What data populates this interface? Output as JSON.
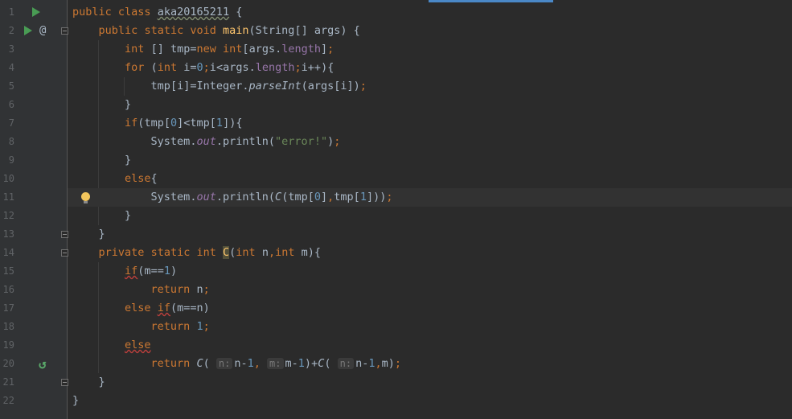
{
  "editor": {
    "lines": [
      {
        "n": "1"
      },
      {
        "n": "2"
      },
      {
        "n": "3"
      },
      {
        "n": "4"
      },
      {
        "n": "5"
      },
      {
        "n": "6"
      },
      {
        "n": "7"
      },
      {
        "n": "8"
      },
      {
        "n": "9"
      },
      {
        "n": "10"
      },
      {
        "n": "11"
      },
      {
        "n": "12"
      },
      {
        "n": "13"
      },
      {
        "n": "14"
      },
      {
        "n": "15"
      },
      {
        "n": "16"
      },
      {
        "n": "17"
      },
      {
        "n": "18"
      },
      {
        "n": "19"
      },
      {
        "n": "20"
      },
      {
        "n": "21"
      },
      {
        "n": "22"
      }
    ],
    "tok": {
      "public": "public",
      "class": "class",
      "classname": "aka20165211",
      "lbrace": "{",
      "rbrace": "}",
      "static": "static",
      "void": "void",
      "main": "main",
      "string": "String",
      "arr": "[]",
      "args": "args",
      "lparen": "(",
      "rparen": ")",
      "int": "int",
      "tmp": "tmp",
      "eq": "=",
      "new": "new",
      "lbr": "[",
      "rbr": "]",
      "dot": ".",
      "length": "length",
      "semi": ";",
      "for": "for",
      "i": "i",
      "zero": "0",
      "one": "1",
      "lt": "<",
      "inc": "++",
      "integer": "Integer",
      "parseInt": "parseInt",
      "if": "if",
      "system": "System",
      "out": "out",
      "println": "println",
      "error": "\"error!\"",
      "else": "else",
      "C": "C",
      "comma": ",",
      "private": "private",
      "n": "n",
      "m": "m",
      "eqeq": "==",
      "return": "return",
      "minus": "-",
      "plus": "+",
      "hint_n": "n:",
      "hint_m": "m:"
    }
  }
}
